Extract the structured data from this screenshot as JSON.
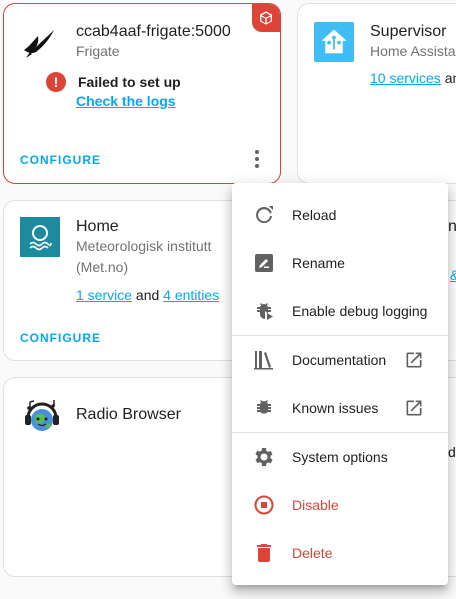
{
  "cards": {
    "frigate": {
      "title": "ccab4aaf-frigate:5000",
      "subtitle": "Frigate",
      "error_text": "Failed to set up",
      "error_link": "Check the logs",
      "configure": "CONFIGURE"
    },
    "supervisor": {
      "title": "Supervisor",
      "subtitle": "Home Assista",
      "services_link": "10 services",
      "trailing": "and"
    },
    "home": {
      "title": "Home",
      "subtitle_line1": "Meteorologisk institutt",
      "subtitle_line2": "(Met.no)",
      "service_link": "1 service",
      "and": "and",
      "entities_link": "4 entities",
      "configure": "CONFIGURE",
      "right_edge": "n",
      "right_edge_link": "&"
    },
    "radio": {
      "title": "Radio Browser",
      "right_edge": "d"
    }
  },
  "menu": {
    "items": [
      {
        "label": "Reload",
        "icon": "reload-icon"
      },
      {
        "label": "Rename",
        "icon": "rename-icon"
      },
      {
        "label": "Enable debug logging",
        "icon": "bug-play-icon"
      },
      {
        "label": "Documentation",
        "icon": "book-icon"
      },
      {
        "label": "Known issues",
        "icon": "bug-icon"
      },
      {
        "label": "System options",
        "icon": "gear-icon"
      },
      {
        "label": "Disable",
        "icon": "stop-circle-icon"
      },
      {
        "label": "Delete",
        "icon": "trash-icon"
      }
    ]
  },
  "colors": {
    "accent": "#03a9f4",
    "error": "#db4437",
    "met_brand": "#1c8b9e",
    "ha_brand": "#41bdf5"
  }
}
